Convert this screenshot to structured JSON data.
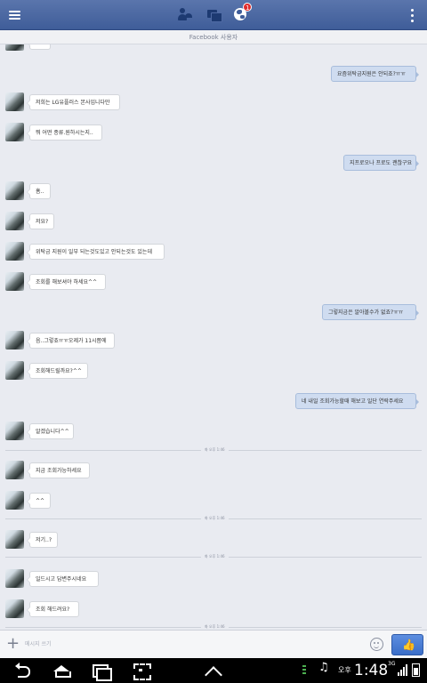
{
  "header": {
    "notification_count": "1",
    "subheader": "Facebook 사용자"
  },
  "messages": [
    {
      "side": "in",
      "text": ""
    },
    {
      "side": "out",
      "text": "요즘위탁금지원은 안되죠?ㅠㅠ"
    },
    {
      "side": "in",
      "text": "저희는 LG유플러스 본사입니다만"
    },
    {
      "side": "in",
      "text": "뭐 어떤 종류.원하시는지.."
    },
    {
      "side": "out",
      "text": "지프로오나 프로도 괜찮구요"
    },
    {
      "side": "in",
      "text": "흠.."
    },
    {
      "side": "in",
      "text": "저요?"
    },
    {
      "side": "in",
      "text": "위탁금 지원이 일부 되는것도있고 안되는것도 있는데"
    },
    {
      "side": "in",
      "text": "조회를 해보셔야 하세요^^"
    },
    {
      "side": "out",
      "text": "그렇지금은 알아볼수가 없죠?ㅠㅠ"
    },
    {
      "side": "in",
      "text": "음..그렇죠ㅠㅠ오제가 11시쯤에"
    },
    {
      "side": "in",
      "text": "조회해드릴까요?^^"
    },
    {
      "side": "out",
      "text": "네 내일 조회가능할때 해보고 일단 연락주세요"
    },
    {
      "side": "in",
      "text": "알겠습니다^^"
    },
    {
      "side": "divider",
      "text": "화 오후 1:46"
    },
    {
      "side": "in",
      "text": "지금 조회가능하세요"
    },
    {
      "side": "in",
      "text": "^^"
    },
    {
      "side": "divider",
      "text": "화 오후 1:46"
    },
    {
      "side": "in",
      "text": "저기..?"
    },
    {
      "side": "divider",
      "text": "화 오후 1:46"
    },
    {
      "side": "in",
      "text": "일드시고 답변주시네요"
    },
    {
      "side": "in",
      "text": "조회 해드려요?"
    },
    {
      "side": "divider",
      "text": "화 오후 1:46"
    }
  ],
  "composer": {
    "placeholder": "메시지 쓰기"
  },
  "status_bar": {
    "ampm": "오후",
    "time": "1:48",
    "network": "3G"
  }
}
